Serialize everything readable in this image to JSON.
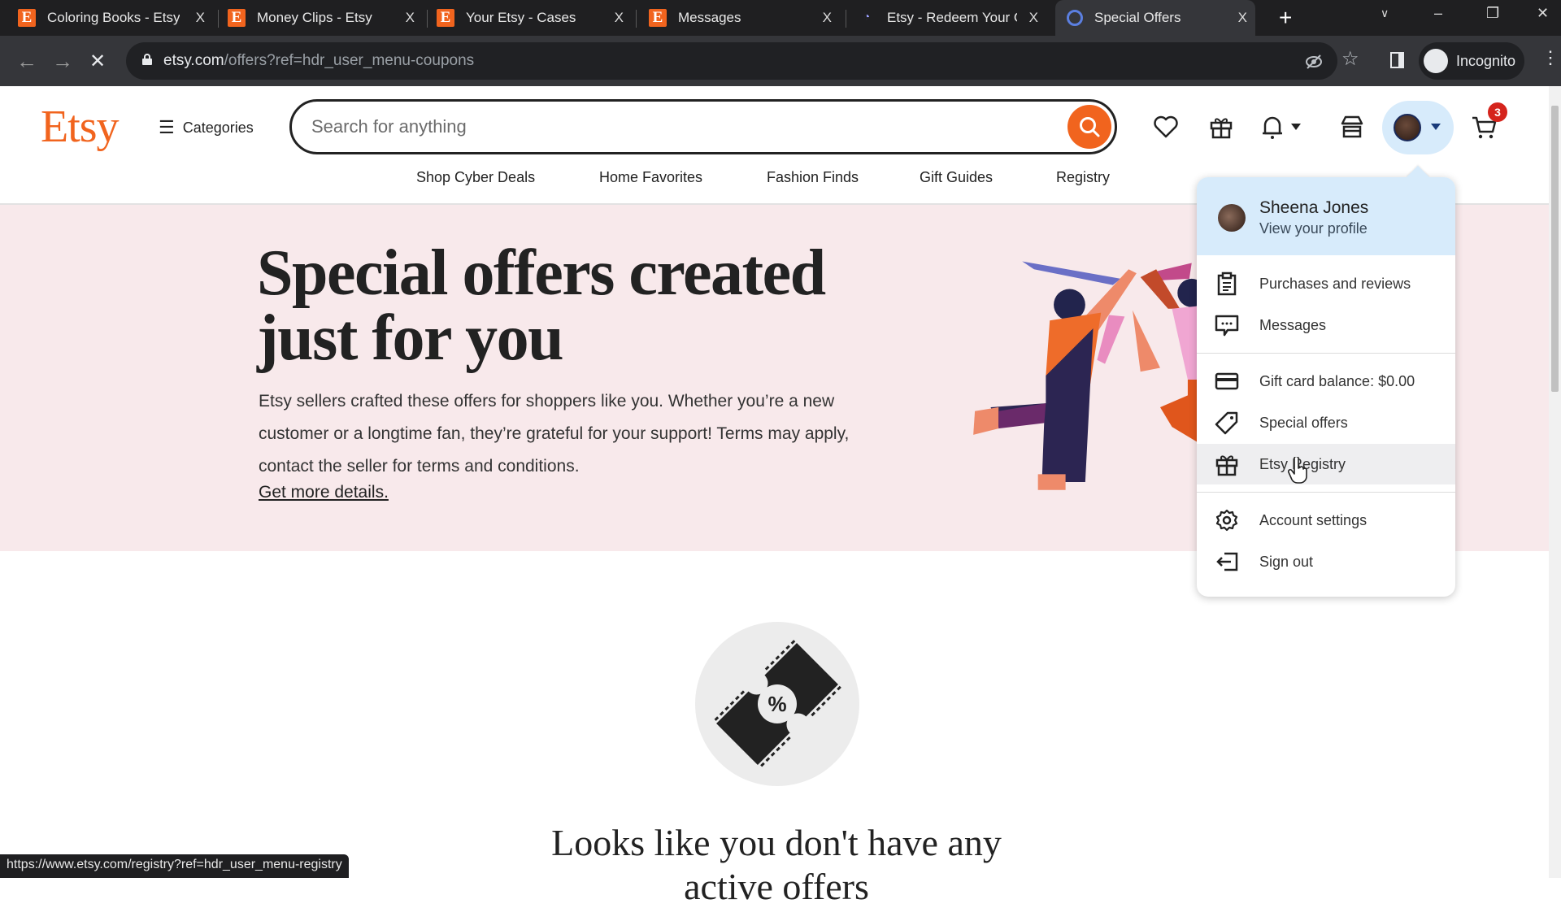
{
  "browser": {
    "tabs": [
      {
        "title": "Coloring Books - Etsy",
        "icon": "etsy-favicon",
        "active": false
      },
      {
        "title": "Money Clips - Etsy",
        "icon": "etsy-favicon",
        "active": false
      },
      {
        "title": "Your Etsy - Cases",
        "icon": "etsy-favicon",
        "active": false
      },
      {
        "title": "Messages",
        "icon": "etsy-favicon",
        "active": false
      },
      {
        "title": "Etsy - Redeem Your G",
        "icon": "loading-favicon",
        "active": false
      },
      {
        "title": "Special Offers",
        "icon": "loading-spinner",
        "active": true
      }
    ],
    "close_glyph": "X",
    "new_tab_glyph": "+",
    "url_host": "etsy.com",
    "url_path": "/offers?ref=hdr_user_menu-coupons",
    "profile_label": "Incognito",
    "status_url": "https://www.etsy.com/registry?ref=hdr_user_menu-registry"
  },
  "header": {
    "logo": "Etsy",
    "categories_label": "Categories",
    "search_placeholder": "Search for anything",
    "cart_count": "3",
    "nav": [
      "Shop Cyber Deals",
      "Home Favorites",
      "Fashion Finds",
      "Gift Guides",
      "Registry"
    ]
  },
  "hero": {
    "title": "Special offers created just for you",
    "body": "Etsy sellers crafted these offers for shoppers like you. Whether you’re a new customer or a longtime fan, they’re grateful for your support! Terms may apply, contact the seller for terms and conditions.",
    "link": "Get more details."
  },
  "empty_state": {
    "title": "Looks like you don't have any",
    "title_line2": "active offers"
  },
  "user_menu": {
    "name": "Sheena Jones",
    "profile_link": "View your profile",
    "items": [
      {
        "label": "Purchases and reviews",
        "icon": "clipboard-icon"
      },
      {
        "label": "Messages",
        "icon": "message-icon"
      },
      {
        "label": "Gift card balance: $0.00",
        "icon": "credit-card-icon"
      },
      {
        "label": "Special offers",
        "icon": "tag-icon"
      },
      {
        "label": "Etsy Registry",
        "icon": "gift-icon",
        "hovered": true
      },
      {
        "label": "Account settings",
        "icon": "gear-icon"
      },
      {
        "label": "Sign out",
        "icon": "sign-out-icon"
      }
    ]
  },
  "colors": {
    "brand": "#f1641e",
    "hero_bg": "#f8e9eb",
    "menu_header_bg": "#d7ebfb",
    "cart_badge": "#d5241c"
  }
}
